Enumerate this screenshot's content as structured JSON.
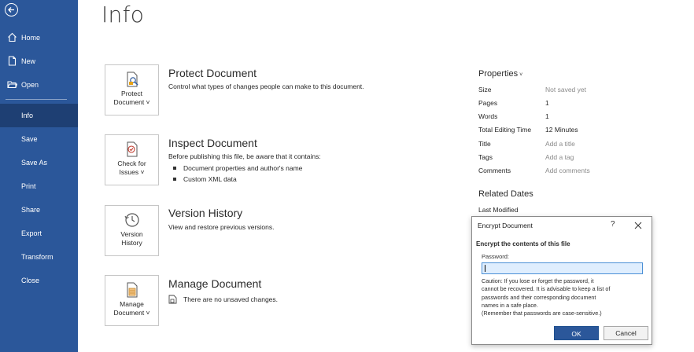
{
  "sidebar": {
    "top_items": [
      {
        "label": "Home",
        "icon": "home-icon"
      },
      {
        "label": "New",
        "icon": "new-document-icon"
      },
      {
        "label": "Open",
        "icon": "folder-open-icon"
      }
    ],
    "bottom_items": [
      {
        "label": "Info"
      },
      {
        "label": "Save"
      },
      {
        "label": "Save As"
      },
      {
        "label": "Print"
      },
      {
        "label": "Share"
      },
      {
        "label": "Export"
      },
      {
        "label": "Transform"
      },
      {
        "label": "Close"
      }
    ],
    "active": "Info"
  },
  "page": {
    "title": "Info"
  },
  "cards": {
    "protect": {
      "btn_line1": "Protect",
      "btn_line2": "Document ˅",
      "title": "Protect Document",
      "desc": "Control what types of changes people can make to this document."
    },
    "inspect": {
      "btn_line1": "Check for",
      "btn_line2": "Issues ˅",
      "title": "Inspect Document",
      "desc": "Before publishing this file, be aware that it contains:",
      "bullets": [
        "Document properties and author's name",
        "Custom XML data"
      ]
    },
    "version": {
      "btn_line1": "Version",
      "btn_line2": "History",
      "title": "Version History",
      "desc": "View and restore previous versions."
    },
    "manage": {
      "btn_line1": "Manage",
      "btn_line2": "Document ˅",
      "title": "Manage Document",
      "desc": "There are no unsaved changes."
    }
  },
  "properties": {
    "heading": "Properties",
    "rows": [
      {
        "key": "Size",
        "value": "Not saved yet",
        "muted": true
      },
      {
        "key": "Pages",
        "value": "1",
        "muted": false
      },
      {
        "key": "Words",
        "value": "1",
        "muted": false
      },
      {
        "key": "Total Editing Time",
        "value": "12 Minutes",
        "muted": false
      },
      {
        "key": "Title",
        "value": "Add a title",
        "muted": true
      },
      {
        "key": "Tags",
        "value": "Add a tag",
        "muted": true
      },
      {
        "key": "Comments",
        "value": "Add comments",
        "muted": true
      }
    ],
    "related_heading": "Related Dates",
    "last_modified_label": "Last Modified"
  },
  "dialog": {
    "title": "Encrypt Document",
    "help": "?",
    "heading": "Encrypt the contents of this file",
    "password_label": "Password:",
    "password_value": "",
    "caution_lines": [
      "Caution: If you lose or forget the password, it",
      "cannot be recovered. It is advisable to keep a list of",
      "passwords and their corresponding document",
      "names in a safe place.",
      "(Remember that passwords are case-sensitive.)"
    ],
    "ok_label": "OK",
    "cancel_label": "Cancel"
  },
  "colors": {
    "sidebar": "#2b579a",
    "sidebar_active": "#1e3f73",
    "accent": "#2b579a"
  }
}
